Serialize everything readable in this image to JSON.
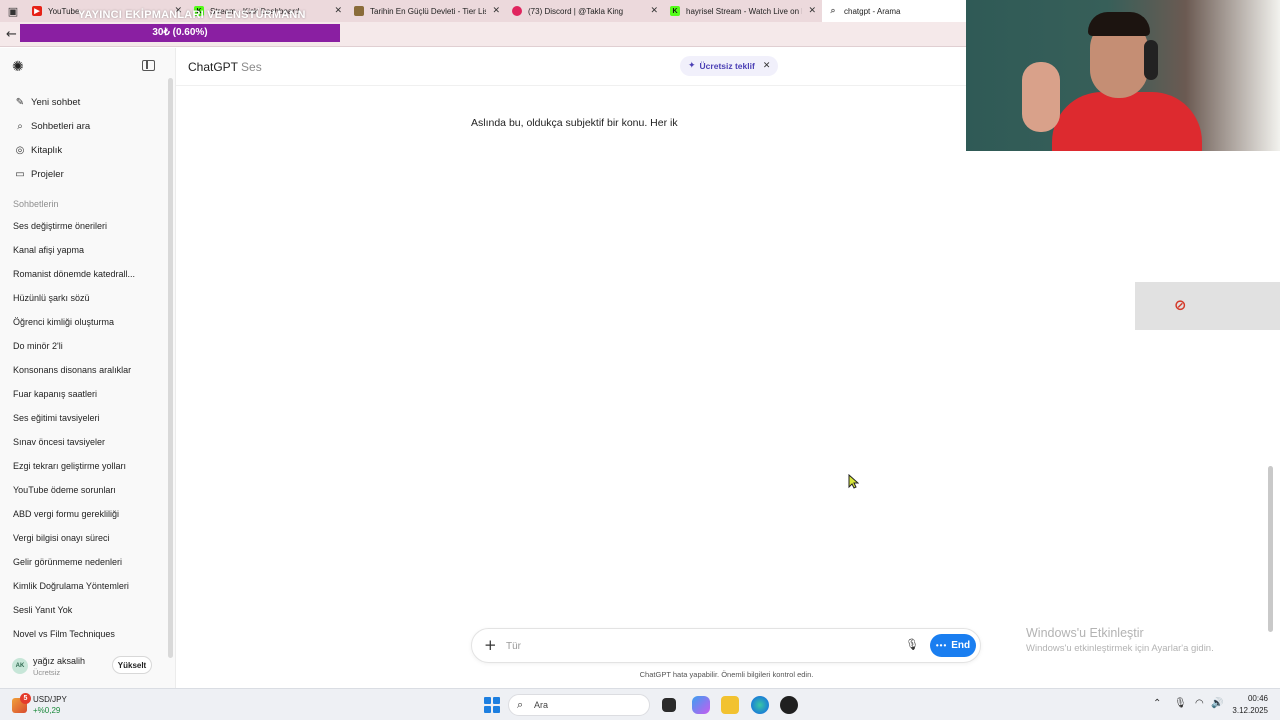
{
  "browser": {
    "tabs": [
      {
        "title": "YouTube",
        "icon": "youtube-icon",
        "color": "#e62117",
        "close": "✕"
      },
      {
        "title": "Stream - Kick Dashboard",
        "icon": "kick-icon",
        "color": "#53fc18",
        "close": "✕"
      },
      {
        "title": "Tarihin En Güçlü Devleti - Tier List",
        "icon": "tierlist-icon",
        "color": "#8a6c3a",
        "close": "✕"
      },
      {
        "title": "(73) Discord | @Takla King",
        "icon": "discord-icon",
        "color": "#e0245e",
        "close": "✕"
      },
      {
        "title": "hayrisel Stream - Watch Live on Kick",
        "icon": "kick-icon",
        "color": "#53fc18",
        "close": "✕"
      },
      {
        "title": "chatgpt - Arama",
        "icon": "search-icon",
        "color": "#6a6a6a",
        "close": ""
      }
    ],
    "back_icon": "back-arrow-icon"
  },
  "overlay": {
    "title": "YAYINCI EKİPMANLARI VE ENSTÜRMANN",
    "goal_text": "30₺ (0.60%)",
    "goal_progress_percent": 0.6,
    "goal_color": "#8a1fa2"
  },
  "sidebar": {
    "nav": [
      {
        "label": "Yeni sohbet",
        "icon": "edit-icon"
      },
      {
        "label": "Sohbetleri ara",
        "icon": "search-icon"
      },
      {
        "label": "Kitaplık",
        "icon": "library-icon"
      },
      {
        "label": "Projeler",
        "icon": "folder-icon"
      }
    ],
    "section_label": "Sohbetlerin",
    "chats": [
      "Ses değiştirme önerileri",
      "Kanal afişi yapma",
      "Romanist dönemde katedrall...",
      "Hüzünlü şarkı sözü",
      "Öğrenci kimliği oluşturma",
      "Do minör 2'li",
      "Konsonans disonans aralıklar",
      "Fuar kapanış saatleri",
      "Ses eğitimi tavsiyeleri",
      "Sınav öncesi tavsiyeler",
      "Ezgi tekrarı geliştirme yolları",
      "YouTube ödeme sorunları",
      "ABD vergi formu gerekliliği",
      "Vergi bilgisi onayı süreci",
      "Gelir görünmeme nedenleri",
      "Kimlik Doğrulama Yöntemleri",
      "Sesli Yanıt Yok",
      "Novel vs Film Techniques"
    ],
    "user": {
      "initials": "AK",
      "name": "yağız aksalih",
      "plan": "Ücretsiz",
      "upgrade_label": "Yükselt"
    }
  },
  "main": {
    "brand": "ChatGPT",
    "brand_sub": "Ses",
    "offer_label": "Ücretsiz teklif",
    "transcript": "Aslında bu, oldukça subjektif bir konu. Her ik",
    "composer": {
      "placeholder": "Tür",
      "end_label": "End",
      "accent": "#1a7ef0"
    },
    "disclaimer": "ChatGPT hata yapabilir. Önemli bilgileri kontrol edin."
  },
  "windows": {
    "activation_title": "Windows'u Etkinleştir",
    "activation_sub": "Windows'u etkinleştirmek için Ayarlar'a gidin."
  },
  "taskbar": {
    "ticker": {
      "badge": "5",
      "name": "USD/JPY",
      "value": "+%0,29"
    },
    "search_placeholder": "Ara",
    "time": "00:46",
    "date": "3.12.2025"
  }
}
